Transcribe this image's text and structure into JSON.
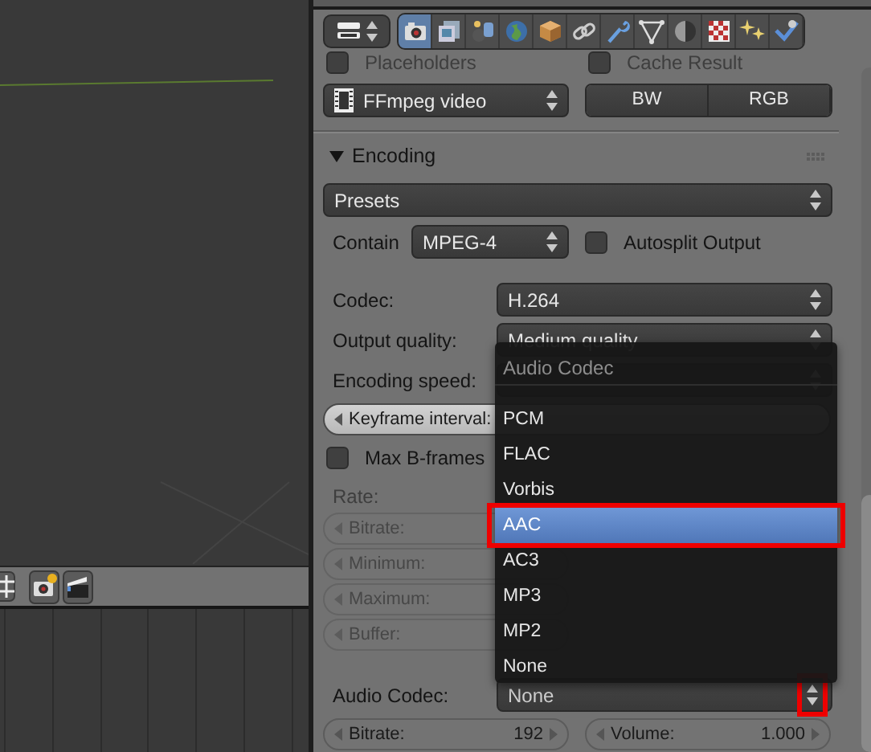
{
  "properties_header": {
    "tabs": [
      {
        "kind": "render",
        "selected": true
      },
      {
        "kind": "render_layers",
        "selected": false
      },
      {
        "kind": "scene",
        "selected": false
      },
      {
        "kind": "world",
        "selected": false
      },
      {
        "kind": "object",
        "selected": false
      },
      {
        "kind": "constraints",
        "selected": false
      },
      {
        "kind": "modifiers",
        "selected": false
      },
      {
        "kind": "data",
        "selected": false
      },
      {
        "kind": "material",
        "selected": false
      },
      {
        "kind": "texture",
        "selected": false
      },
      {
        "kind": "particles",
        "selected": false
      },
      {
        "kind": "physics",
        "selected": false
      }
    ]
  },
  "options": [
    {
      "label": "Placeholders",
      "checked": false
    },
    {
      "label": "Cache Result",
      "checked": false
    }
  ],
  "output": {
    "format": "FFmpeg video",
    "color_modes": [
      "BW",
      "RGB"
    ]
  },
  "encoding": {
    "title": "Encoding",
    "expanded": true,
    "presets": "Presets",
    "container_label": "Contain",
    "container": "MPEG-4",
    "autosplit": {
      "label": "Autosplit Output",
      "checked": false
    },
    "settings": [
      {
        "kind": "select",
        "label": "Codec:",
        "value": "H.264"
      },
      {
        "kind": "select",
        "label": "Output quality:",
        "value": "Medium quality"
      },
      {
        "kind": "select",
        "label": "Encoding speed:"
      },
      {
        "kind": "number",
        "label": "Keyframe interval:",
        "disabled": false,
        "hovered": true
      },
      {
        "kind": "checkbox",
        "label": "Max B-frames",
        "checked": false
      },
      {
        "kind": "heading",
        "label": "Rate:"
      },
      {
        "kind": "number",
        "label": "Bitrate:",
        "disabled": true,
        "hovered": false
      },
      {
        "kind": "number",
        "label": "Minimum:",
        "disabled": true,
        "hovered": false
      },
      {
        "kind": "number",
        "label": "Maximum:",
        "disabled": true,
        "hovered": false
      },
      {
        "kind": "number",
        "label": "Buffer:",
        "disabled": true,
        "hovered": false
      }
    ],
    "audio_codec": {
      "label": "Audio Codec:",
      "value": "None",
      "highlighted": true
    },
    "audio_settings": [
      {
        "label": "Bitrate:",
        "value": "192"
      },
      {
        "label": "Volume:",
        "value": "1.000"
      }
    ]
  },
  "menu": {
    "title": "Audio Codec",
    "items": [
      {
        "label": "PCM",
        "selected": false,
        "highlighted": false
      },
      {
        "label": "FLAC",
        "selected": false,
        "highlighted": false
      },
      {
        "label": "Vorbis",
        "selected": false,
        "highlighted": false
      },
      {
        "label": "AAC",
        "selected": true,
        "highlighted": true
      },
      {
        "label": "AC3",
        "selected": false,
        "highlighted": false
      },
      {
        "label": "MP3",
        "selected": false,
        "highlighted": false
      },
      {
        "label": "MP2",
        "selected": false,
        "highlighted": false
      },
      {
        "label": "None",
        "selected": false,
        "highlighted": false
      }
    ]
  }
}
